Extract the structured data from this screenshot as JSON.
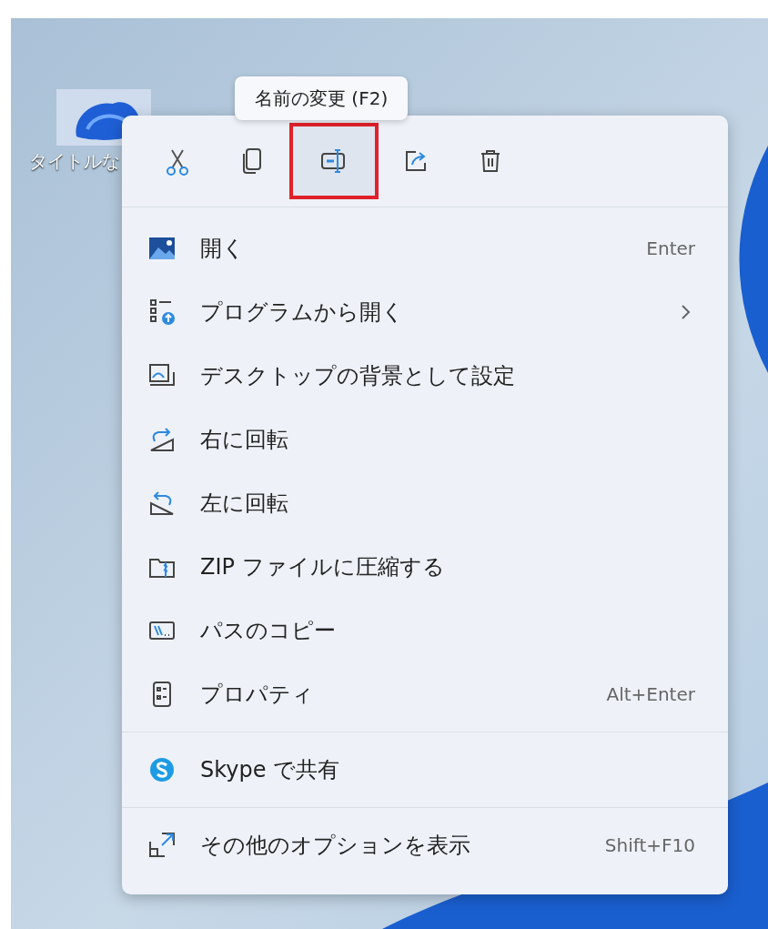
{
  "desktop": {
    "icon_label": "タイトルな"
  },
  "tooltip": {
    "text": "名前の変更 (F2)"
  },
  "toolbar": [
    {
      "kind": "cut",
      "highlighted": false
    },
    {
      "kind": "copy",
      "highlighted": false
    },
    {
      "kind": "rename",
      "highlighted": true
    },
    {
      "kind": "share",
      "highlighted": false
    },
    {
      "kind": "delete",
      "highlighted": false
    }
  ],
  "menu_sections": [
    [
      {
        "kind": "open",
        "label": "開く",
        "shortcut": "Enter",
        "submenu": false
      },
      {
        "kind": "open-with",
        "label": "プログラムから開く",
        "submenu": true
      },
      {
        "kind": "wallpaper",
        "label": "デスクトップの背景として設定",
        "submenu": false
      },
      {
        "kind": "rotate-right",
        "label": "右に回転",
        "submenu": false
      },
      {
        "kind": "rotate-left",
        "label": "左に回転",
        "submenu": false
      },
      {
        "kind": "zip",
        "label": "ZIP ファイルに圧縮する",
        "submenu": false
      },
      {
        "kind": "copy-path",
        "label": "パスのコピー",
        "submenu": false
      },
      {
        "kind": "properties",
        "label": "プロパティ",
        "shortcut": "Alt+Enter",
        "submenu": false
      }
    ],
    [
      {
        "kind": "skype",
        "label": "Skype で共有",
        "submenu": false
      }
    ],
    [
      {
        "kind": "more",
        "label": "その他のオプションを表示",
        "shortcut": "Shift+F10",
        "submenu": false
      }
    ]
  ]
}
